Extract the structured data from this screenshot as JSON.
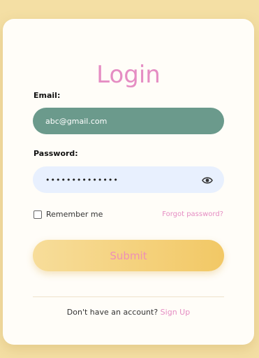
{
  "login": {
    "title": "Login",
    "email_label": "Email:",
    "email_value": "abc@gmail.com",
    "password_label": "Password:",
    "password_value": "••••••••••••••",
    "remember_label": "Remember me",
    "remember_checked": false,
    "forgot_link": "Forgot password?",
    "submit_label": "Submit",
    "signup_prompt": "Don't have an account?",
    "signup_link": "Sign Up"
  },
  "icons": {
    "password_toggle": "eye-icon"
  },
  "colors": {
    "background": "#f4dfa4",
    "card": "#fffdf8",
    "accent_pink": "#e58dc3",
    "email_field_bg": "#6b9a8c",
    "password_field_bg": "#e8f0fe",
    "submit_gradient_start": "#f7dd9a",
    "submit_gradient_end": "#f2c865"
  }
}
